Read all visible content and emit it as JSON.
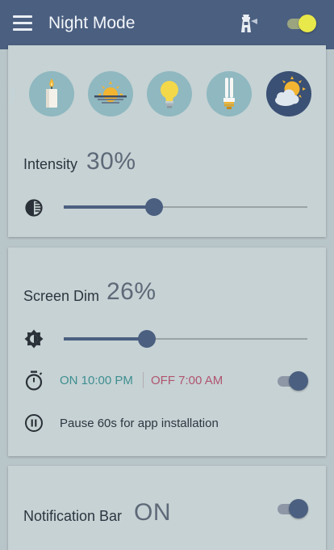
{
  "appbar": {
    "title": "Night Mode",
    "icons": {
      "menu": "hamburger-menu-icon",
      "tower": "lighthouse-icon"
    },
    "main_toggle": {
      "on": true,
      "thumb_color": "#e8e84a"
    }
  },
  "presets": {
    "items": [
      {
        "name": "candle",
        "selected": false
      },
      {
        "name": "sunset",
        "selected": false
      },
      {
        "name": "light-bulb",
        "selected": false
      },
      {
        "name": "fluorescent-lamp",
        "selected": false
      },
      {
        "name": "sun-behind-cloud",
        "selected": true
      }
    ]
  },
  "intensity": {
    "label": "Intensity",
    "value": "30%",
    "level": 0.37,
    "icon": "contrast-icon"
  },
  "screen_dim": {
    "label": "Screen Dim",
    "value": "26%",
    "level": 0.34,
    "icon": "brightness-icon",
    "schedule": {
      "on_text": "ON 10:00 PM",
      "off_text": "OFF 7:00 AM",
      "enabled": true,
      "icon": "stopwatch-icon"
    },
    "pause": {
      "text": "Pause 60s for app installation",
      "icon": "pause-circle-icon"
    }
  },
  "notification_bar": {
    "label": "Notification Bar",
    "value": "ON",
    "enabled": true
  },
  "colors": {
    "primary": "#4b5f80",
    "on_time": "#3f8e90",
    "off_time": "#b0556f",
    "card": "#c6d2d4",
    "background": "#b9c6c9"
  }
}
